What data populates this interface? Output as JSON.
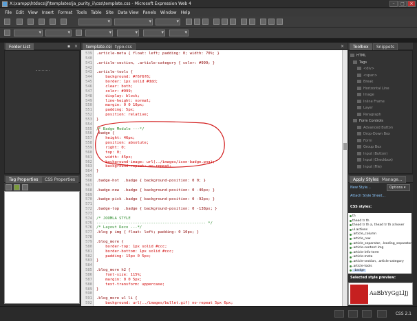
{
  "window": {
    "title": "X:\\xampp\\htdocs\\jf\\templates\\ja_purity_ii\\css\\template.css - Microsoft Expression Web 4"
  },
  "menu": [
    "File",
    "Edit",
    "View",
    "Insert",
    "Format",
    "Tools",
    "Table",
    "Site",
    "Data View",
    "Panels",
    "Window",
    "Help"
  ],
  "left_panel": {
    "tab": "Folder List"
  },
  "left_bottom": {
    "tabs": [
      "Tag Properties",
      "CSS Properties"
    ]
  },
  "editor": {
    "tabs": [
      "template.css",
      "typo.css"
    ],
    "lines": [
      {
        "n": "539",
        "t": ".article-meta { float: left; padding: 0; width: 70%; }"
      },
      {
        "n": "540",
        "t": ""
      },
      {
        "n": "541",
        "t": ".article-section, .article-category { color: #999; }"
      },
      {
        "n": "542",
        "t": ""
      },
      {
        "n": "543",
        "t": ".article-tools {"
      },
      {
        "n": "544",
        "t": "    background: #f6f6f6;"
      },
      {
        "n": "545",
        "t": "    border: 1px solid #ddd;"
      },
      {
        "n": "546",
        "t": "    clear: both;"
      },
      {
        "n": "547",
        "t": "    color: #999;"
      },
      {
        "n": "548",
        "t": "    display: block;"
      },
      {
        "n": "549",
        "t": "    line-height: normal;"
      },
      {
        "n": "550",
        "t": "    margin: 0 0 10px;"
      },
      {
        "n": "551",
        "t": "    padding: 5px;"
      },
      {
        "n": "552",
        "t": "    position: relative;"
      },
      {
        "n": "553",
        "t": "}"
      },
      {
        "n": "554",
        "t": ""
      },
      {
        "n": "555",
        "t": "/* Badge Module ---*/"
      },
      {
        "n": "556",
        "t": ".badge {"
      },
      {
        "n": "557",
        "t": "    height: 46px;"
      },
      {
        "n": "558",
        "t": "    position: absolute;"
      },
      {
        "n": "559",
        "t": "    right: 0;"
      },
      {
        "n": "560",
        "t": "    top: 0;"
      },
      {
        "n": "561",
        "t": "    width: 45px;"
      },
      {
        "n": "562",
        "t": "    background-image: url(../images/icon-badge.png);"
      },
      {
        "n": "563",
        "t": "    background-repeat: no-repeat;"
      },
      {
        "n": "564",
        "t": "}"
      },
      {
        "n": "565",
        "t": ""
      },
      {
        "n": "566",
        "t": ".badge-hot  .badge { background-position: 0 0; }"
      },
      {
        "n": "567",
        "t": ""
      },
      {
        "n": "568",
        "t": ".badge-new  .badge { background-position: 0 -46px; }"
      },
      {
        "n": "569",
        "t": ""
      },
      {
        "n": "570",
        "t": ".badge-pick .badge { background-position: 0 -92px; }"
      },
      {
        "n": "571",
        "t": ""
      },
      {
        "n": "572",
        "t": ".badge-top  .badge { background-position: 0 -138px; }"
      },
      {
        "n": "573",
        "t": ""
      },
      {
        "n": "574",
        "t": "/* JOOMLA STYLE"
      },
      {
        "n": "575",
        "t": "------------------------------------------------ */"
      },
      {
        "n": "576",
        "t": "/* Layout Deco ---*/"
      },
      {
        "n": "577",
        "t": ".blog p img { float: left; padding: 0 10px; }"
      },
      {
        "n": "578",
        "t": ""
      },
      {
        "n": "579",
        "t": ".blog_more {"
      },
      {
        "n": "580",
        "t": "    border-top: 1px solid #ccc;"
      },
      {
        "n": "581",
        "t": "    border-bottom: 1px solid #ccc;"
      },
      {
        "n": "582",
        "t": "    padding: 15px 0 5px;"
      },
      {
        "n": "583",
        "t": "}"
      },
      {
        "n": "584",
        "t": ""
      },
      {
        "n": "585",
        "t": ".blog_more h2 {"
      },
      {
        "n": "586",
        "t": "    font-size: 115%;"
      },
      {
        "n": "587",
        "t": "    margin: 0 0 5px;"
      },
      {
        "n": "588",
        "t": "    text-transform: uppercase;"
      },
      {
        "n": "589",
        "t": "}"
      },
      {
        "n": "590",
        "t": ""
      },
      {
        "n": "591",
        "t": ".blog_more ul li {"
      },
      {
        "n": "592",
        "t": "    background: url(../images/bullet.gif) no-repeat 5px 6px;"
      },
      {
        "n": "593",
        "t": "    padding-left: 15px;"
      }
    ]
  },
  "toolbox": {
    "tabs": [
      "Toolbox",
      "Snippets"
    ],
    "items": [
      "HTML",
      "Tags",
      "<div>",
      "<span>",
      "Break",
      "Horizontal Line",
      "Image",
      "Inline Frame",
      "Layer",
      "Paragraph",
      "Form Controls",
      "Advanced Button",
      "Drop-Down Box",
      "Form",
      "Group Box",
      "Input (Button)",
      "Input (Checkbox)",
      "Input (File)"
    ]
  },
  "styles_panel": {
    "tabs": [
      "Apply Styles",
      "Manage..."
    ],
    "new_style": "New Style...",
    "options": "Options",
    "attach": "Attach Style Sheet...",
    "css_styles_label": "CSS styles:",
    "styles": [
      "th",
      "thead tr th",
      "thead tr th a, thead tr th a:hover",
      "ul.actions",
      ".article_column",
      ".article_row",
      ".article_separator, .leading_separator",
      ".article-content img",
      ".article-info-term",
      ".article-meta",
      ".article-section, .article-category",
      ".article-tools",
      ".badge"
    ],
    "preview_label": "Selected style preview:",
    "preview_text": "AaBbYyGgLlJj"
  },
  "statusbar": {
    "css_version": "CSS 2.1"
  },
  "colors": {
    "comment": "#2a8a2a",
    "selector": "#8b0000",
    "property": "#d00000",
    "value": "#1a1aff",
    "annotation": "#d21a1a"
  }
}
